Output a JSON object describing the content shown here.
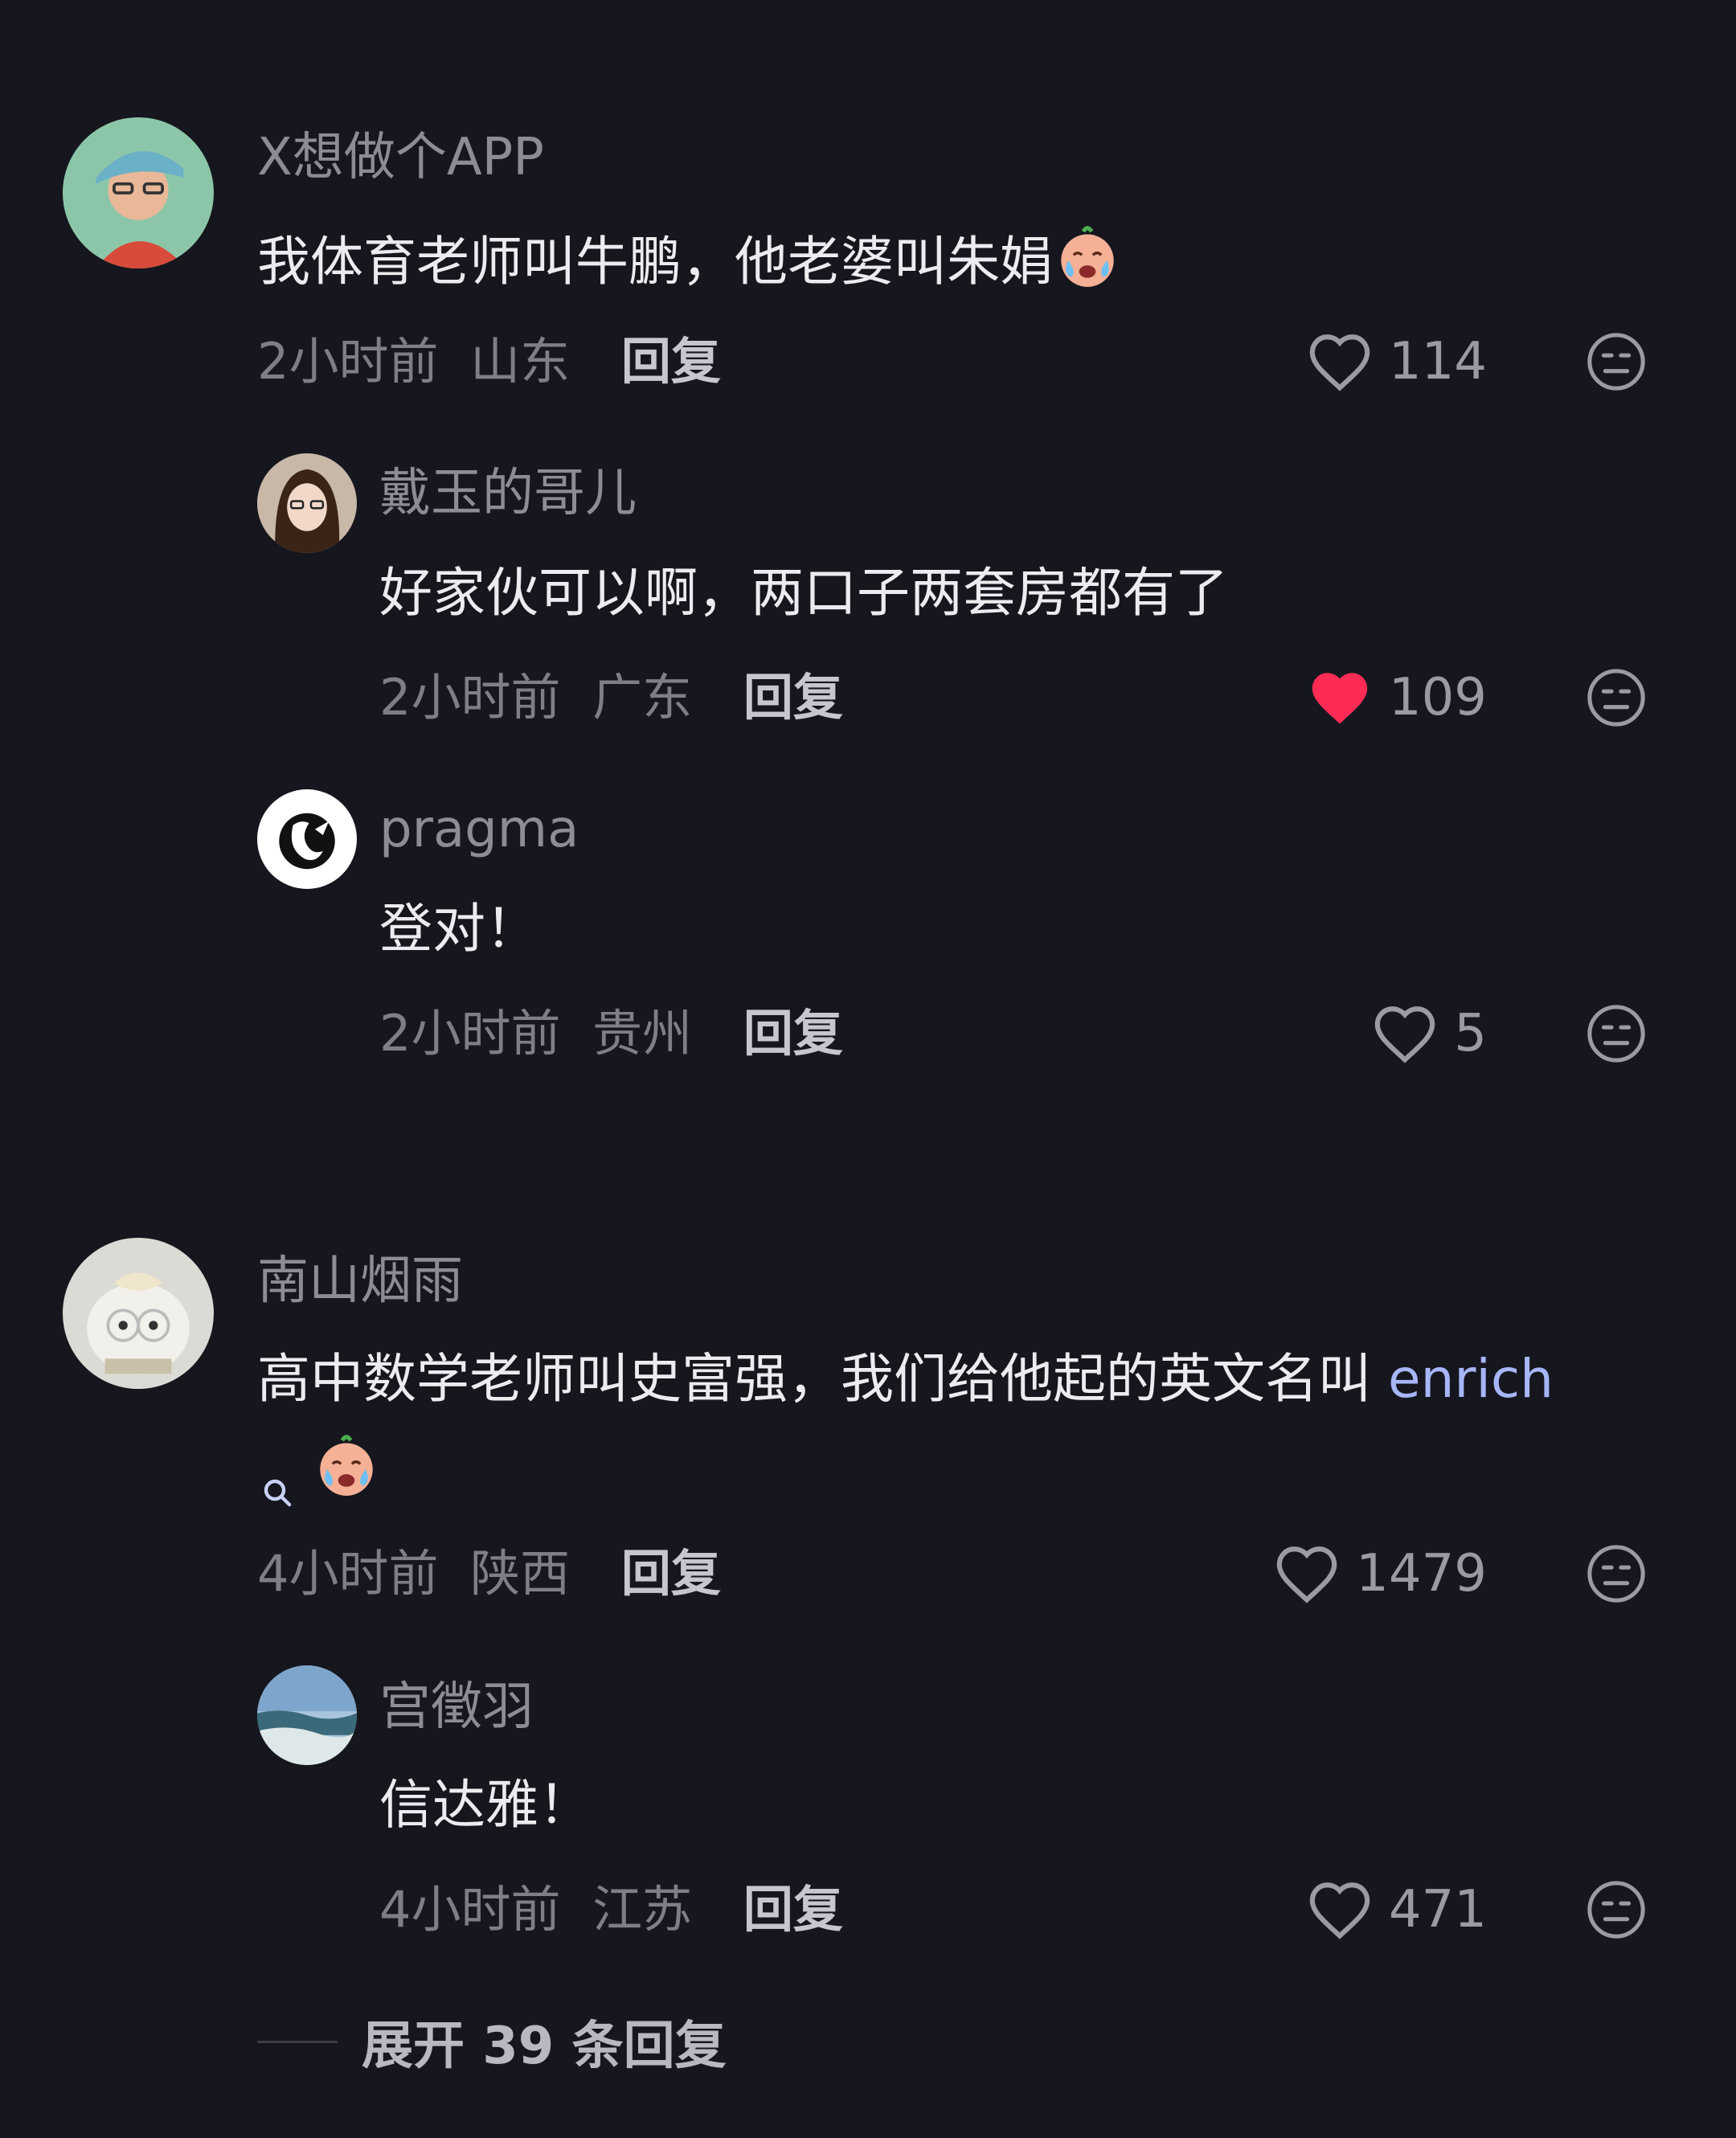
{
  "comments": [
    {
      "username": "X想做个APP",
      "text": "我体育老师叫牛鹏，他老婆叫朱娟",
      "time": "2小时前",
      "location": "山东",
      "reply_label": "回复",
      "likes": "114",
      "liked": false,
      "avatar_icon": "avatar-man-cap",
      "emoji": "crying-face-emoji"
    },
    {
      "username": "戴玉的哥儿",
      "text": "好家伙可以啊，两口子两套房都有了",
      "time": "2小时前",
      "location": "广东",
      "reply_label": "回复",
      "likes": "109",
      "liked": true,
      "avatar_icon": "avatar-woman-glasses"
    },
    {
      "username": "pragma",
      "text": "登对！",
      "time": "2小时前",
      "location": "贵州",
      "reply_label": "回复",
      "likes": "5",
      "liked": false,
      "avatar_icon": "avatar-swan-logo"
    },
    {
      "username": "南山烟雨",
      "text": "高中数学老师叫史富强，我们给他起的英文名叫",
      "link_word": "enrich",
      "time": "4小时前",
      "location": "陕西",
      "reply_label": "回复",
      "likes": "1479",
      "liked": false,
      "avatar_icon": "avatar-plush-toy",
      "emoji": "crying-face-emoji"
    },
    {
      "username": "宫徵羽",
      "text": "信达雅！",
      "time": "4小时前",
      "location": "江苏",
      "reply_label": "回复",
      "likes": "471",
      "liked": false,
      "avatar_icon": "avatar-sea-landscape"
    }
  ],
  "expand_label": "展开 39 条回复",
  "colors": {
    "background": "#16161e",
    "liked_heart": "#fe2c55",
    "link": "#a6b6f8"
  }
}
